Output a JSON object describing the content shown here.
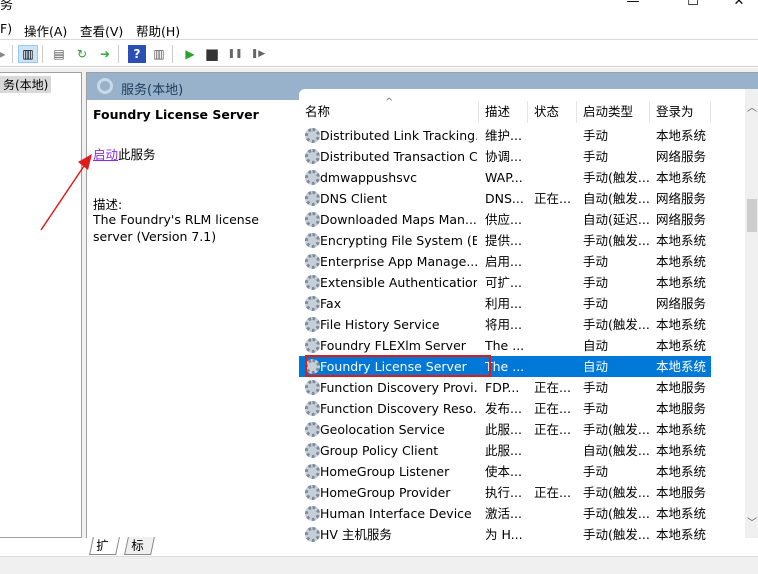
{
  "window": {
    "title": "务",
    "controls": {
      "minimize": "—",
      "maximize": "☐",
      "close": "✕"
    }
  },
  "menu": [
    "F)",
    "操作(A)",
    "查看(V)",
    "帮助(H)"
  ],
  "toolbar": {
    "icons": [
      "back-icon",
      "show-hide-tree-icon",
      "properties-icon",
      "refresh-icon",
      "export-list-icon",
      "help-icon",
      "show-action-pane-icon",
      "start-service-icon",
      "stop-service-icon",
      "pause-service-icon",
      "resume-service-icon"
    ],
    "glyphs": {
      "play": "▶",
      "stop": "■",
      "pause": "❚❚",
      "resume": "❚▶",
      "help": "?"
    }
  },
  "tree": {
    "selected": "务(本地)"
  },
  "pane": {
    "header": "服务(本地)",
    "selected_service": "Foundry License Server",
    "action_link": "启动",
    "action_suffix": "此服务",
    "desc_label": "描述:",
    "desc_text": "The Foundry's RLM license server (Version 7.1)"
  },
  "list": {
    "columns": [
      "名称",
      "描述",
      "状态",
      "启动类型",
      "登录为"
    ],
    "sort_indicator": "^",
    "rows": [
      {
        "name": "Distributed Link Tracking...",
        "desc": "维护...",
        "status": "",
        "startup": "手动",
        "logon": "本地系统"
      },
      {
        "name": "Distributed Transaction C...",
        "desc": "协调...",
        "status": "",
        "startup": "手动",
        "logon": "网络服务"
      },
      {
        "name": "dmwappushsvc",
        "desc": "WAP...",
        "status": "",
        "startup": "手动(触发...",
        "logon": "本地系统"
      },
      {
        "name": "DNS Client",
        "desc": "DNS...",
        "status": "正在...",
        "startup": "自动(触发...",
        "logon": "网络服务"
      },
      {
        "name": "Downloaded Maps Man...",
        "desc": "供应...",
        "status": "",
        "startup": "自动(延迟...",
        "logon": "网络服务"
      },
      {
        "name": "Encrypting File System (E...",
        "desc": "提供...",
        "status": "",
        "startup": "手动(触发...",
        "logon": "本地系统"
      },
      {
        "name": "Enterprise App Manage...",
        "desc": "启用...",
        "status": "",
        "startup": "手动",
        "logon": "本地系统"
      },
      {
        "name": "Extensible Authentication...",
        "desc": "可扩...",
        "status": "",
        "startup": "手动",
        "logon": "本地系统"
      },
      {
        "name": "Fax",
        "desc": "利用...",
        "status": "",
        "startup": "手动",
        "logon": "网络服务"
      },
      {
        "name": "File History Service",
        "desc": "将用...",
        "status": "",
        "startup": "手动(触发...",
        "logon": "本地系统"
      },
      {
        "name": "Foundry FLEXlm Server",
        "desc": "The ...",
        "status": "",
        "startup": "自动",
        "logon": "本地系统"
      },
      {
        "name": "Foundry License Server",
        "desc": "The ...",
        "status": "",
        "startup": "自动",
        "logon": "本地系统",
        "selected": true
      },
      {
        "name": "Function Discovery Provi...",
        "desc": "FDP...",
        "status": "正在...",
        "startup": "手动",
        "logon": "本地服务"
      },
      {
        "name": "Function Discovery Reso...",
        "desc": "发布...",
        "status": "正在...",
        "startup": "手动",
        "logon": "本地服务"
      },
      {
        "name": "Geolocation Service",
        "desc": "此服...",
        "status": "正在...",
        "startup": "手动(触发...",
        "logon": "本地系统"
      },
      {
        "name": "Group Policy Client",
        "desc": "此服...",
        "status": "",
        "startup": "自动(触发...",
        "logon": "本地系统"
      },
      {
        "name": "HomeGroup Listener",
        "desc": "使本...",
        "status": "",
        "startup": "手动",
        "logon": "本地系统"
      },
      {
        "name": "HomeGroup Provider",
        "desc": "执行...",
        "status": "正在...",
        "startup": "手动(触发...",
        "logon": "本地服务"
      },
      {
        "name": "Human Interface Device ...",
        "desc": "激活...",
        "status": "",
        "startup": "手动(触发...",
        "logon": "本地系统"
      },
      {
        "name": "HV 主机服务",
        "desc": "为 H...",
        "status": "",
        "startup": "手动(触发...",
        "logon": "本地系统"
      }
    ]
  },
  "tabs": [
    "扩展",
    "标准"
  ],
  "colors": {
    "selection": "#0078d7",
    "header_band": "#98b2cb",
    "highlight_box": "#e01b1b",
    "annotation_arrow": "#e01b1b",
    "link": "#8a2be2"
  }
}
